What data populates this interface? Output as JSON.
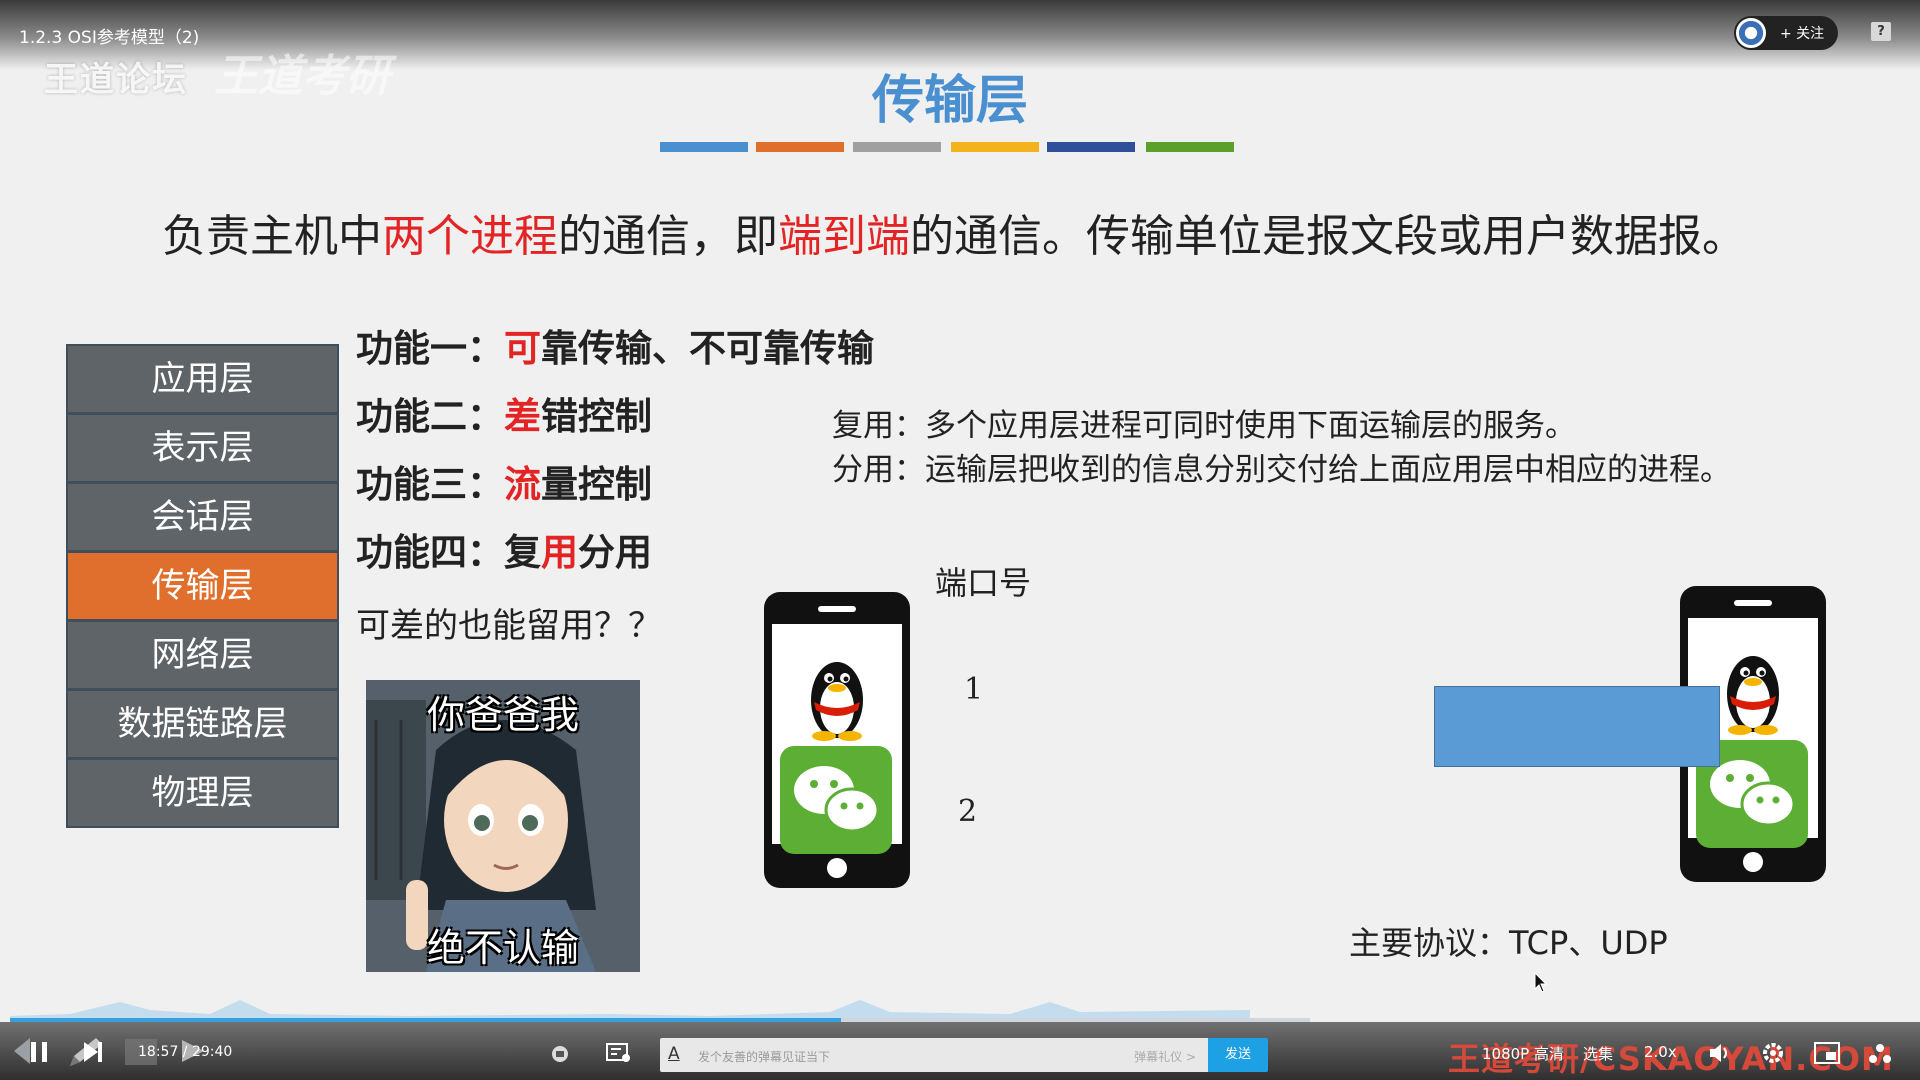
{
  "player": {
    "video_title": "1.2.3 OSI参考模型（2)",
    "watermark_logo": "王道论坛",
    "watermark_logo_2": "王道考研",
    "follow_label": "+ 关注",
    "help_glyph": "?",
    "time_current": "18:57",
    "time_total": "29:40",
    "time_display": "18:57 / 29:40",
    "progress_fraction": 0.639,
    "danmaku_a": "A",
    "danmaku_placeholder": "发个友善的弹幕见证当下",
    "danmaku_etiquette": "弹幕礼仪 >",
    "send_label": "发送",
    "brand_watermark": "王道考研/CSKAOYAN.COM",
    "quality_label": "1080P 高清",
    "episodes_label": "选集",
    "speed_label": "2.0x",
    "accent_color": "#1ea0e5"
  },
  "slide": {
    "title": "传输层",
    "color_bars": [
      "#4a8fd0",
      "#e06e2c",
      "#a0a0a0",
      "#f2b31c",
      "#2f4f9a",
      "#5aa02c"
    ],
    "description": {
      "part1": "负责主机中",
      "highlight1": "两个进程",
      "part2": "的通信，即",
      "highlight2": "端到端",
      "part3": "的通信。传输单位是报文段或用户数据报。"
    },
    "layers": [
      "应用层",
      "表示层",
      "会话层",
      "传输层",
      "网络层",
      "数据链路层",
      "物理层"
    ],
    "active_layer": "传输层",
    "functions": [
      {
        "prefix": "功能一：",
        "highlight": "可",
        "rest": "靠传输、不可靠传输"
      },
      {
        "prefix": "功能二：",
        "highlight": "差",
        "rest": "错控制"
      },
      {
        "prefix": "功能三：",
        "highlight": "流",
        "rest": "量控制"
      },
      {
        "prefix": "功能四：",
        "highlight_pre": "复",
        "highlight": "用",
        "rest": "分用"
      }
    ],
    "question": "可差的也能留用？？",
    "meme_top": "你爸爸我",
    "meme_bottom": "绝不认输",
    "multiplexing": "复用：多个应用层进程可同时使用下面运输层的服务。",
    "demultiplexing": "分用：运输层把收到的信息分别交付给上面应用层中相应的进程。",
    "port_label": "端口号",
    "port_1": "1",
    "port_2": "2",
    "protocol_text": "主要协议：TCP、UDP"
  }
}
